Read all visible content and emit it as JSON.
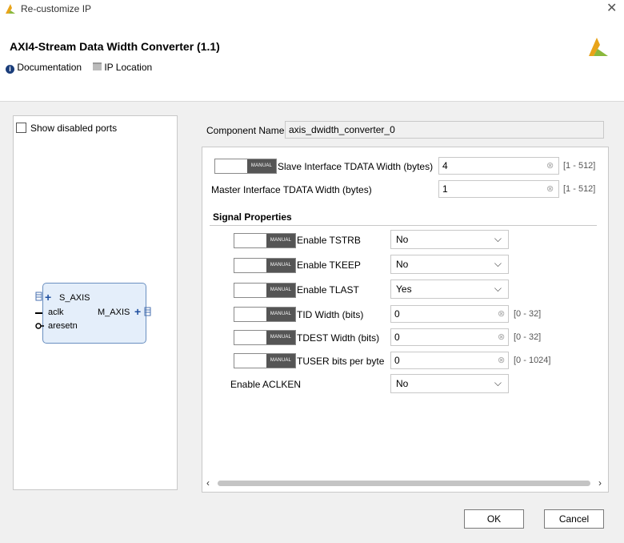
{
  "window": {
    "title": "Re-customize IP"
  },
  "header": {
    "title": "AXI4-Stream Data Width Converter (1.1)"
  },
  "links": {
    "documentation": "Documentation",
    "ip_location": "IP Location"
  },
  "left": {
    "show_disabled_ports": "Show disabled ports",
    "block": {
      "s_axis": "S_AXIS",
      "aclk": "aclk",
      "aresetn": "aresetn",
      "m_axis": "M_AXIS"
    }
  },
  "component": {
    "label": "Component Name",
    "value": "axis_dwidth_converter_0"
  },
  "toggle_label": "MANUAL",
  "params": {
    "slave_tdata": {
      "label": "Slave Interface TDATA Width (bytes)",
      "value": "4",
      "range": "[1 - 512]"
    },
    "master_tdata": {
      "label": "Master Interface TDATA Width (bytes)",
      "value": "1",
      "range": "[1 - 512]"
    }
  },
  "signal_properties": {
    "heading": "Signal Properties",
    "tstrb": {
      "label": "Enable TSTRB",
      "value": "No"
    },
    "tkeep": {
      "label": "Enable TKEEP",
      "value": "No"
    },
    "tlast": {
      "label": "Enable TLAST",
      "value": "Yes"
    },
    "tid": {
      "label": "TID Width (bits)",
      "value": "0",
      "range": "[0 - 32]"
    },
    "tdest": {
      "label": "TDEST Width (bits)",
      "value": "0",
      "range": "[0 - 32]"
    },
    "tuser": {
      "label": "TUSER bits per byte",
      "value": "0",
      "range": "[0 - 1024]"
    },
    "aclken": {
      "label": "Enable ACLKEN",
      "value": "No"
    }
  },
  "buttons": {
    "ok": "OK",
    "cancel": "Cancel"
  },
  "colors": {
    "vivado_logo": "#e8a41a",
    "logo_green": "#8ab83c",
    "manual_toggle": "#555555"
  }
}
